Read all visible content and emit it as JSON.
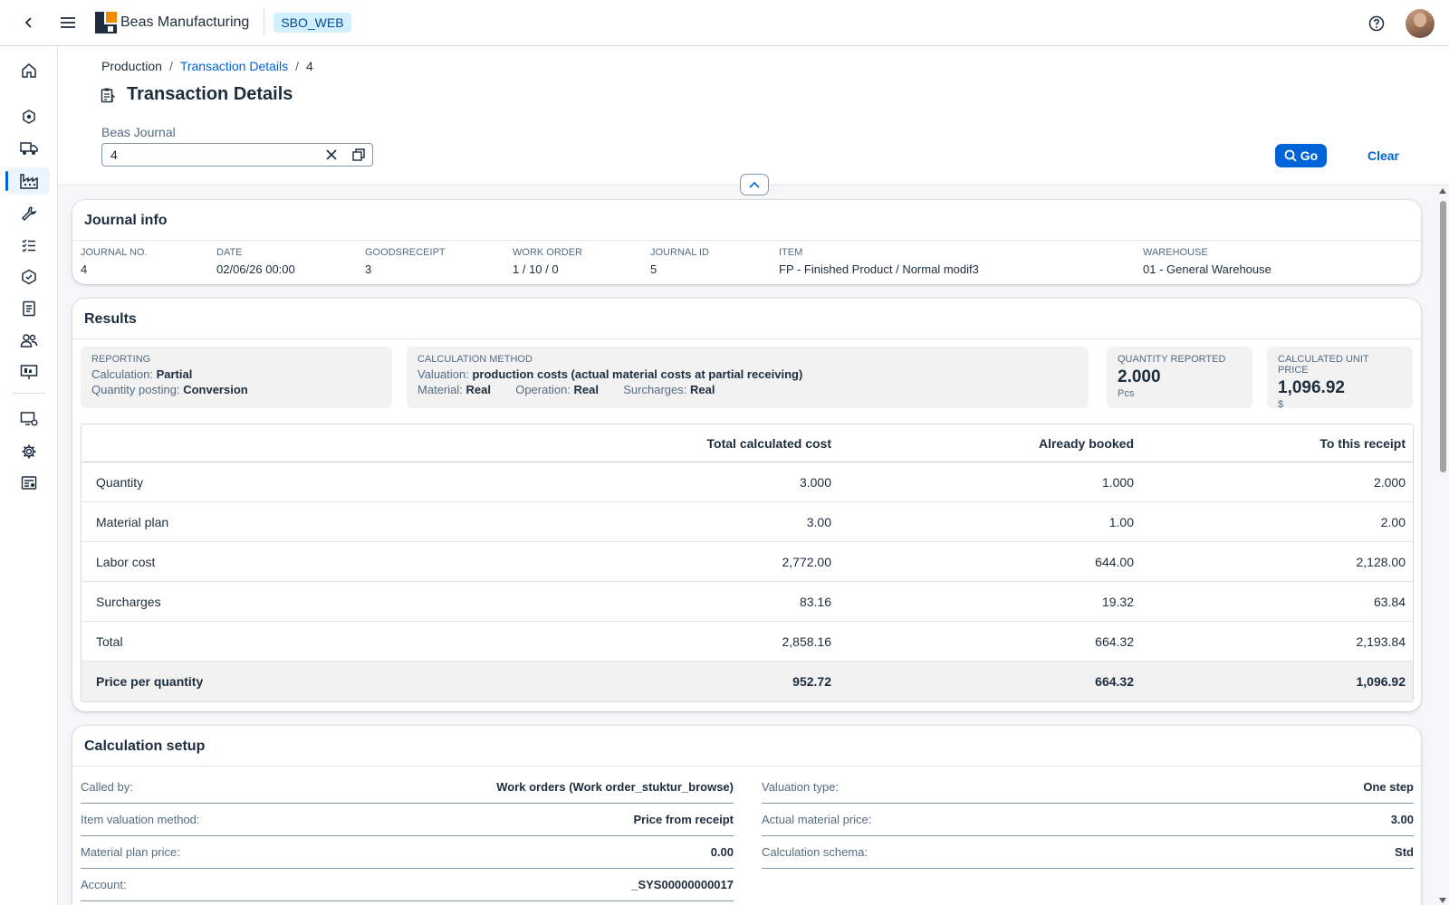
{
  "shell": {
    "app_name": "Beas Manufacturing",
    "system": "SBO_WEB"
  },
  "breadcrumb": {
    "root": "Production",
    "parent": "Transaction Details",
    "current": "4"
  },
  "header": {
    "title": "Transaction Details",
    "filter_label": "Beas Journal",
    "filter_value": "4",
    "go_label": "Go",
    "clear_label": "Clear"
  },
  "nav": {
    "icons": [
      "home-icon",
      "cube-network-icon",
      "delivery-truck-icon",
      "factory-icon",
      "wrench-icon",
      "task-list-icon",
      "product-box-icon",
      "document-icon",
      "people-group-icon",
      "presentation-icon",
      "settings-monitor-icon",
      "gear-icon",
      "report-icon"
    ],
    "active": "factory-icon"
  },
  "journal_info": {
    "title": "Journal info",
    "fields": [
      {
        "label": "Journal No.",
        "value": "4"
      },
      {
        "label": "Date",
        "value": "02/06/26 00:00"
      },
      {
        "label": "GoodsReceipt",
        "value": "3"
      },
      {
        "label": "Work order",
        "value": "1 / 10 / 0"
      },
      {
        "label": "Journal ID",
        "value": "5"
      },
      {
        "label": "Item",
        "value": "FP - Finished Product / Normal modif3"
      },
      {
        "label": "Warehouse",
        "value": "01 - General Warehouse"
      }
    ]
  },
  "results": {
    "title": "Results",
    "reporting": {
      "label": "Reporting",
      "calc_key": "Calculation:",
      "calc_val": "Partial",
      "qp_key": "Quantity posting:",
      "qp_val": "Conversion"
    },
    "calc_method": {
      "label": "Calculation method",
      "valuation_key": "Valuation:",
      "valuation_val": "production costs (actual material costs at partial receiving)",
      "material_key": "Material:",
      "material_val": "Real",
      "operation_key": "Operation:",
      "operation_val": "Real",
      "surcharges_key": "Surcharges:",
      "surcharges_val": "Real"
    },
    "qty_reported": {
      "label": "Quantity reported",
      "value": "2.000",
      "unit": "Pcs"
    },
    "unit_price": {
      "label": "Calculated unit price",
      "value": "1,096.92",
      "unit": "$"
    },
    "table": {
      "columns": [
        "",
        "Total calculated cost",
        "Already booked",
        "To this receipt"
      ],
      "rows": [
        {
          "label": "Quantity",
          "total": "3.000",
          "booked": "1.000",
          "receipt": "2.000"
        },
        {
          "label": "Material plan",
          "total": "3.00",
          "booked": "1.00",
          "receipt": "2.00"
        },
        {
          "label": "Labor cost",
          "total": "2,772.00",
          "booked": "644.00",
          "receipt": "2,128.00"
        },
        {
          "label": "Surcharges",
          "total": "83.16",
          "booked": "19.32",
          "receipt": "63.84"
        },
        {
          "label": "Total",
          "total": "2,858.16",
          "booked": "664.32",
          "receipt": "2,193.84"
        }
      ],
      "footer": {
        "label": "Price per quantity",
        "total": "952.72",
        "booked": "664.32",
        "receipt": "1,096.92"
      }
    }
  },
  "calc_setup": {
    "title": "Calculation setup",
    "left": [
      {
        "label": "Called by:",
        "value": "Work orders (Work order_stuktur_browse)"
      },
      {
        "label": "Item valuation method:",
        "value": "Price from receipt"
      },
      {
        "label": "Material plan price:",
        "value": "0.00"
      },
      {
        "label": "Account:",
        "value": "_SYS00000000017"
      }
    ],
    "right": [
      {
        "label": "Valuation type:",
        "value": "One step"
      },
      {
        "label": "Actual material price:",
        "value": "3.00"
      },
      {
        "label": "Calculation schema:",
        "value": "Std"
      }
    ]
  },
  "colors": {
    "accent": "#0064d9",
    "text": "#1d2d3e",
    "muted": "#556b82",
    "badge_bg": "#d1efff",
    "page_bg": "#f5f6f7"
  }
}
